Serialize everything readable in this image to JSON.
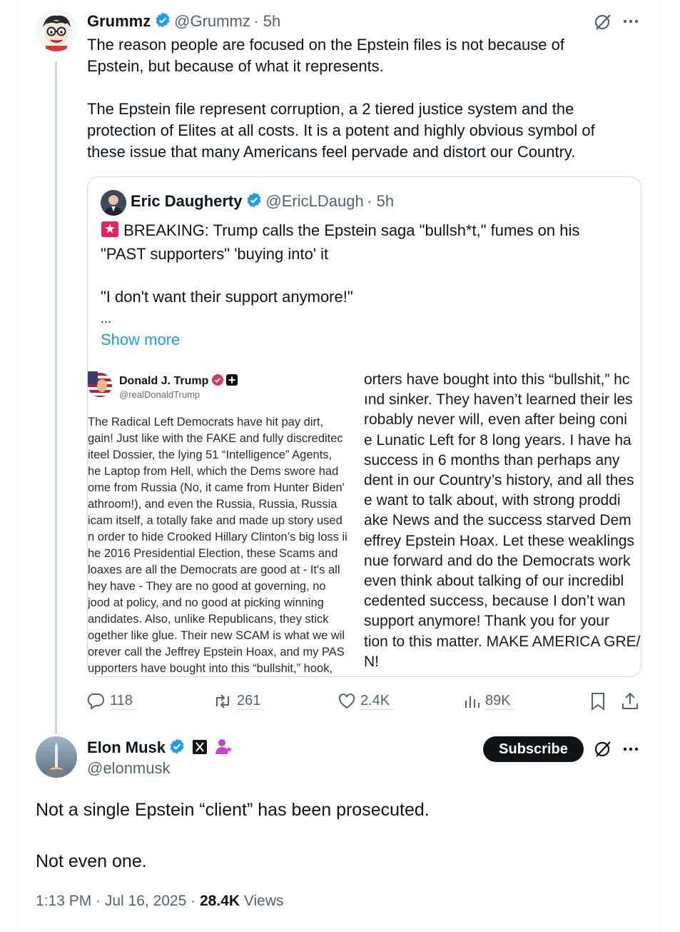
{
  "tweet": {
    "author_name": "Grummz",
    "handle": "@Grummz",
    "time": "· 5h",
    "paragraph1": [
      "The reason people are focused on the Epstein files is not because of",
      "Epstein, but because of what it represents."
    ],
    "paragraph2": [
      "The Epstein file represent corruption, a 2 tiered justice system and the",
      "protection of Elites at all costs. It is a potent and highly obvious symbol of",
      "these issue that many Americans feel pervade and distort our Country."
    ],
    "actions": {
      "replies": "118",
      "reposts": "261",
      "likes": "2.4K",
      "views": "89K"
    }
  },
  "quote": {
    "author_name": "Eric Daugherty",
    "handle": "@EricLDaugh",
    "time": "· 5h",
    "line1": "BREAKING: Trump calls the Epstein saga \"bullsh*t,\" fumes on his",
    "line2": "\"PAST supporters\" 'buying into' it",
    "line3": "\"I don't want their support anymore!\"",
    "ellipsis": "...",
    "show_more": "Show more",
    "embedded": {
      "name": "Donald J. Trump",
      "handle": "@realDonaldTrump",
      "left_lines": [
        "The Radical Left Democrats have hit pay dirt,",
        "gain! Just like with the FAKE and fully discreditec",
        "iteel Dossier, the lying 51 “Intelligence” Agents,",
        "he Laptop from Hell, which the Dems swore had",
        "ome from Russia (No, it came from Hunter Biden'",
        "athroom!), and even the Russia, Russia, Russia",
        "icam itself, a totally fake and made up story used",
        "n order to hide Crooked Hillary Clinton’s big loss ii",
        "he 2016 Presidential Election, these Scams and",
        "loaxes are all the Democrats are good at - It's all",
        "hey have - They are no good at governing, no",
        "jood at policy, and no good at picking winning",
        "andidates. Also, unlike Republicans, they stick",
        "ogether like glue. Their new SCAM is what we wil",
        "orever call the Jeffrey Epstein Hoax, and my PAS",
        "upporters have bought into this “bullshit,” hook,"
      ],
      "right_lines": [
        "orters have bought into this “bullshit,” hc",
        "ınd sinker. They haven’t learned their les",
        "robably never will, even after being coni",
        "e Lunatic Left for 8 long years. I have ha",
        "success in 6 months than perhaps any",
        "dent in our Country’s history, and all thes",
        "e want to talk about, with strong proddi",
        "ake News and the success starved Dem",
        "effrey Epstein Hoax. Let these weaklings",
        "nue forward and do the Democrats work",
        "even think about talking of our incredibl",
        "cedented success, because I don’t wan",
        "support anymore! Thank you for your",
        "tion to this matter. MAKE AMERICA GRE/",
        "N!"
      ]
    }
  },
  "reply": {
    "author_name": "Elon Musk",
    "handle": "@elonmusk",
    "subscribe_label": "Subscribe",
    "text1": "Not a single Epstein “client” has been prosecuted.",
    "text2": "Not even one.",
    "timestamp": "1:13 PM · Jul 16, 2025 ·",
    "views_count": "28.4K",
    "views_label": "Views"
  },
  "colors": {
    "accent": "#1d9bf0",
    "verified": "#1d9bf0",
    "text": "#0f1419",
    "secondary": "#536471"
  }
}
